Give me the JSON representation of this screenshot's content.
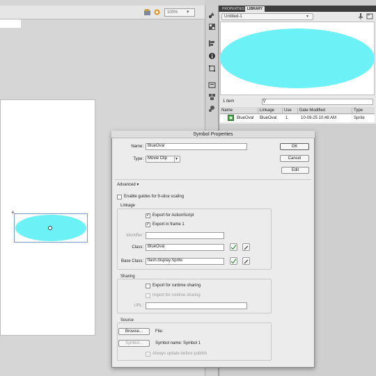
{
  "stage": {
    "zoom": "100%"
  },
  "library": {
    "tabs": [
      "PROPERTIES",
      "LIBRARY"
    ],
    "document": "Untitled-1",
    "item_count": "1 item",
    "columns": [
      "Name",
      "Linkage",
      "Use",
      "Date Modified",
      "Type"
    ],
    "rows": [
      {
        "name": "BlueOval",
        "linkage": "BlueOval",
        "use": "1",
        "date": "10-09-25 10:48 AM",
        "type": "Sprite"
      }
    ]
  },
  "dialog": {
    "title": "Symbol Properties",
    "name_label": "Name:",
    "name_value": "BlueOval",
    "type_label": "Type:",
    "type_value": "Movie Clip",
    "ok": "OK",
    "cancel": "Cancel",
    "edit": "Edit",
    "advanced": "Advanced",
    "nine_slice": "Enable guides for 9-slice scaling",
    "linkage_title": "Linkage",
    "export_as": "Export for ActionScript",
    "export_frame1": "Export in frame 1",
    "identifier_label": "Identifier:",
    "class_label": "Class:",
    "class_value": "BlueOval",
    "base_class_label": "Base Class:",
    "base_class_value": "flash.display.Sprite",
    "sharing_title": "Sharing",
    "export_runtime": "Export for runtime sharing",
    "import_runtime": "Import for runtime sharing",
    "url_label": "URL:",
    "source_title": "Source",
    "browse": "Browse...",
    "file_label": "File:",
    "symbol_btn": "Symbol...",
    "symbol_name": "Symbol name: Symbol 1",
    "always_update": "Always update before publish"
  },
  "colors": {
    "oval": "#6cf2f6",
    "selection": "#7a9ac9"
  }
}
